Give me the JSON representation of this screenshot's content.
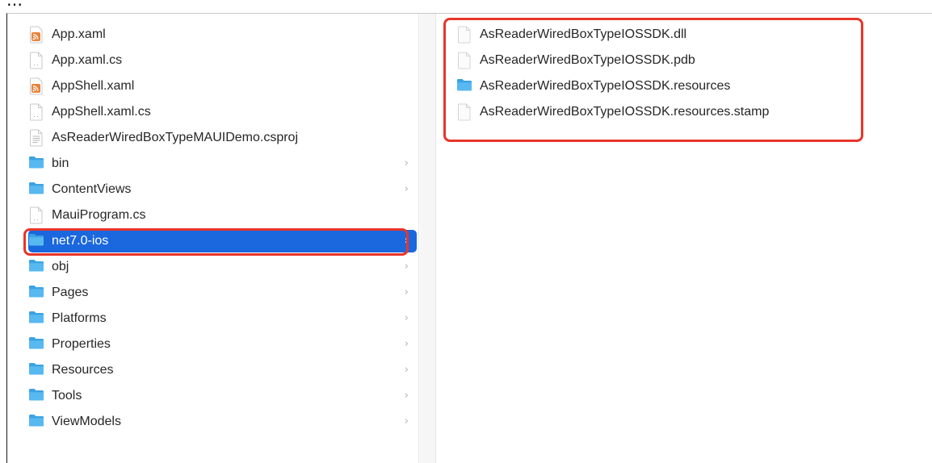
{
  "caption_fragment": "…",
  "sidebar": {
    "items": [
      {
        "label": "App.xaml",
        "icon": "rss-file-icon",
        "has_children": false,
        "selected": false
      },
      {
        "label": "App.xaml.cs",
        "icon": "code-file-icon",
        "has_children": false,
        "selected": false
      },
      {
        "label": "AppShell.xaml",
        "icon": "rss-file-icon",
        "has_children": false,
        "selected": false
      },
      {
        "label": "AppShell.xaml.cs",
        "icon": "code-file-icon",
        "has_children": false,
        "selected": false
      },
      {
        "label": "AsReaderWiredBoxTypeMAUIDemo.csproj",
        "icon": "document-file-icon",
        "has_children": false,
        "selected": false
      },
      {
        "label": "bin",
        "icon": "folder-icon",
        "has_children": true,
        "selected": false
      },
      {
        "label": "ContentViews",
        "icon": "folder-icon",
        "has_children": true,
        "selected": false
      },
      {
        "label": "MauiProgram.cs",
        "icon": "code-file-icon",
        "has_children": false,
        "selected": false
      },
      {
        "label": "net7.0-ios",
        "icon": "folder-icon",
        "has_children": true,
        "selected": true
      },
      {
        "label": "obj",
        "icon": "folder-icon",
        "has_children": true,
        "selected": false
      },
      {
        "label": "Pages",
        "icon": "folder-icon",
        "has_children": true,
        "selected": false
      },
      {
        "label": "Platforms",
        "icon": "folder-icon",
        "has_children": true,
        "selected": false
      },
      {
        "label": "Properties",
        "icon": "folder-icon",
        "has_children": true,
        "selected": false
      },
      {
        "label": "Resources",
        "icon": "folder-icon",
        "has_children": true,
        "selected": false
      },
      {
        "label": "Tools",
        "icon": "folder-icon",
        "has_children": true,
        "selected": false
      },
      {
        "label": "ViewModels",
        "icon": "folder-icon",
        "has_children": true,
        "selected": false
      }
    ]
  },
  "content": {
    "items": [
      {
        "label": "AsReaderWiredBoxTypeIOSSDK.dll",
        "icon": "blank-file-icon"
      },
      {
        "label": "AsReaderWiredBoxTypeIOSSDK.pdb",
        "icon": "blank-file-icon"
      },
      {
        "label": "AsReaderWiredBoxTypeIOSSDK.resources",
        "icon": "folder-icon"
      },
      {
        "label": "AsReaderWiredBoxTypeIOSSDK.resources.stamp",
        "icon": "blank-file-icon"
      }
    ]
  },
  "colors": {
    "selection": "#1a67de",
    "highlight": "#e8352a",
    "folder": "#3aa3e3",
    "rss": "#e8823a"
  }
}
